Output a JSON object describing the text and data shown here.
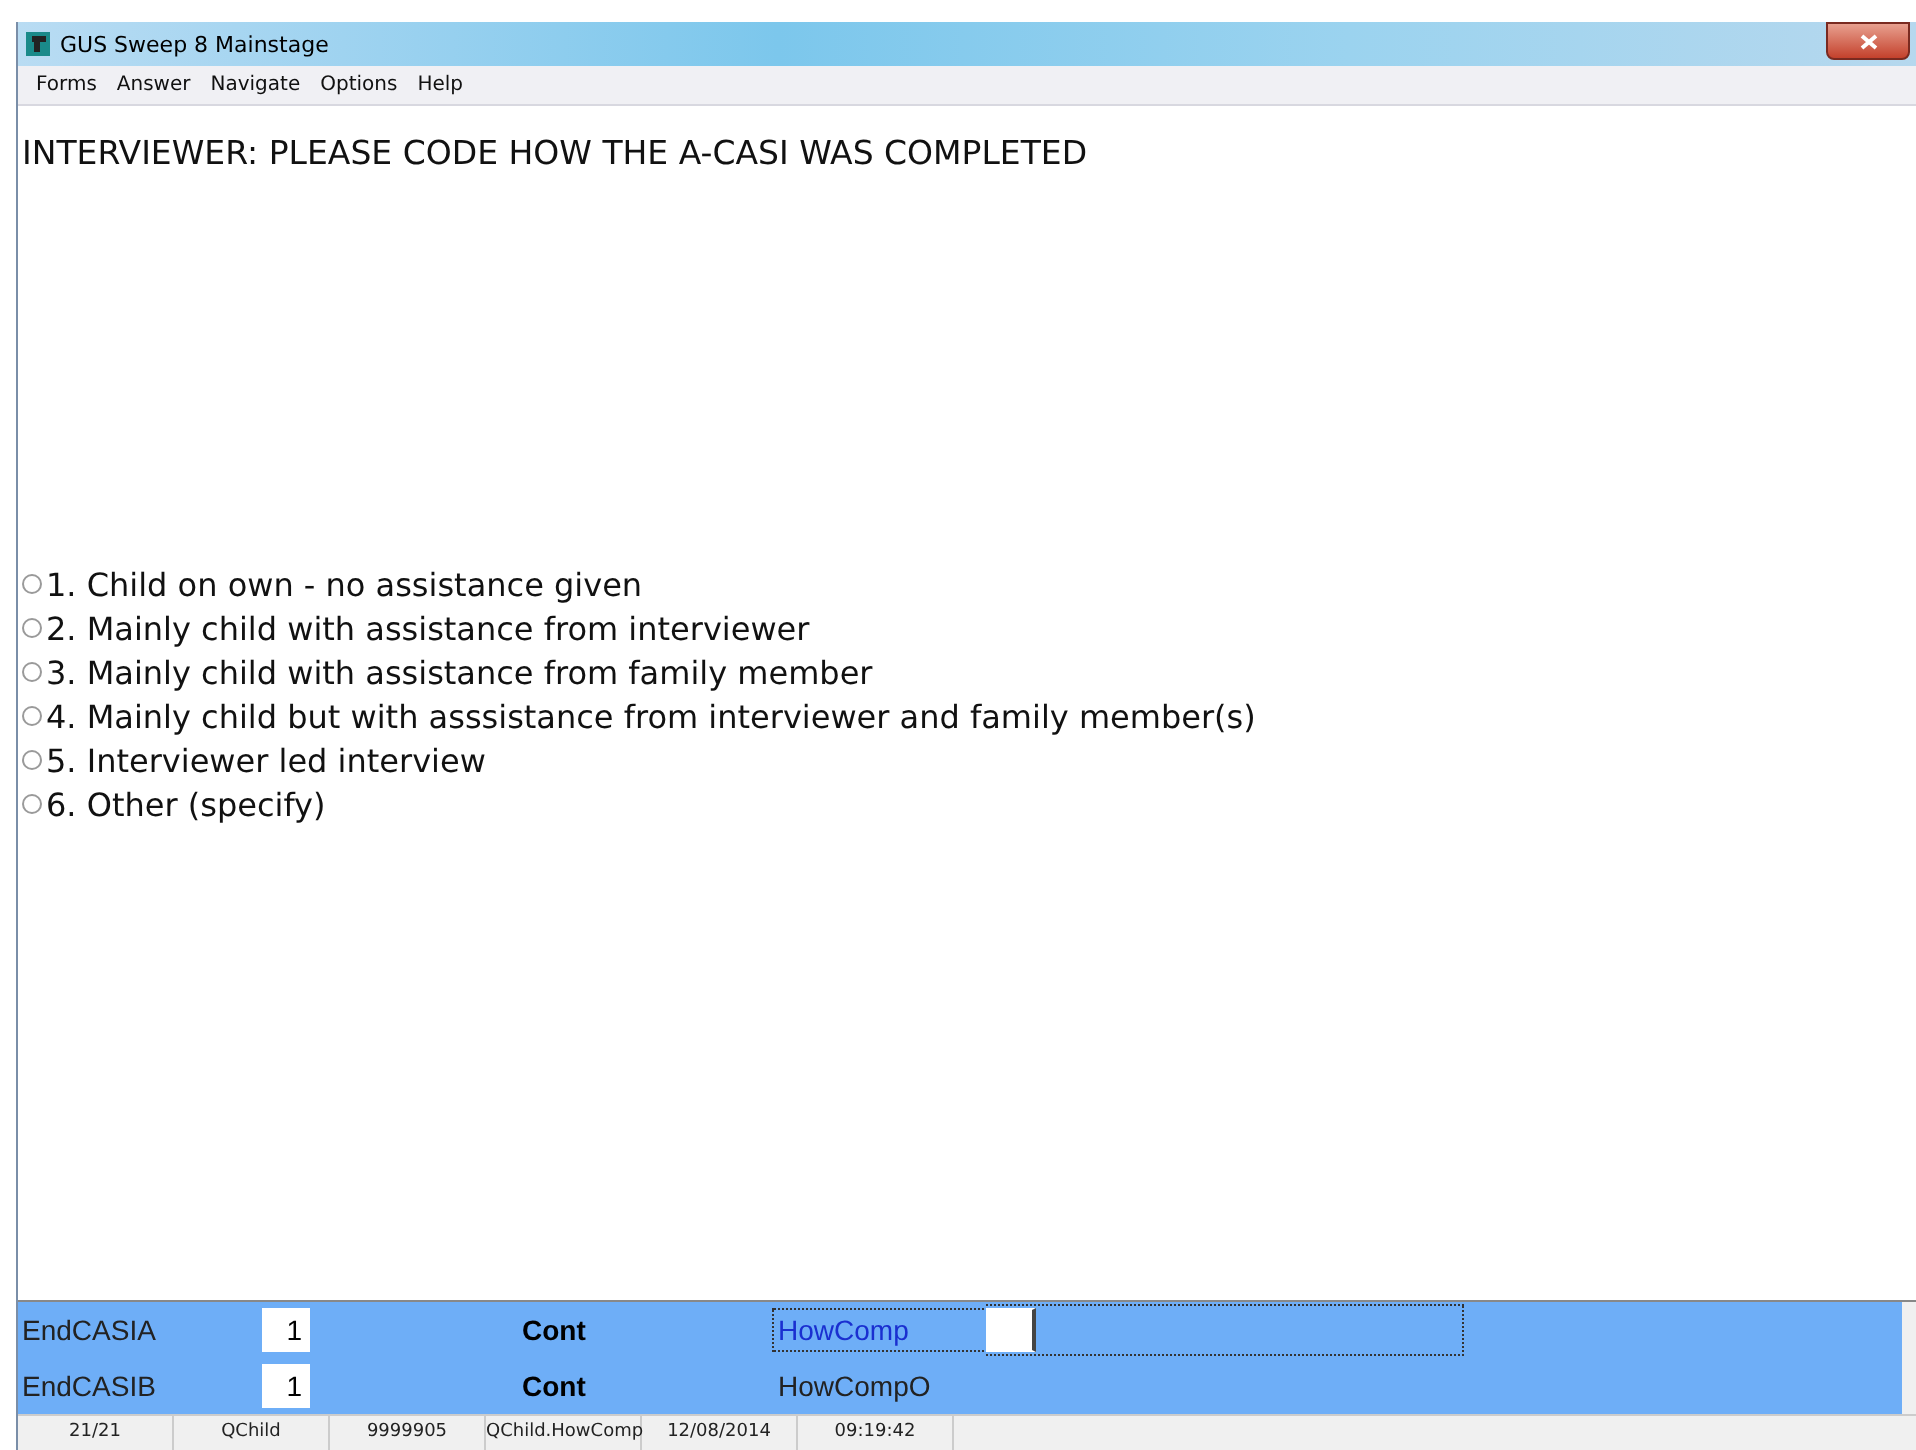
{
  "window": {
    "title": "GUS Sweep 8 Mainstage"
  },
  "menu": [
    "Forms",
    "Answer",
    "Navigate",
    "Options",
    "Help"
  ],
  "question": "INTERVIEWER: PLEASE CODE HOW THE A-CASI WAS COMPLETED",
  "options": [
    {
      "label": "1. Child on own - no assistance given",
      "selected": false
    },
    {
      "label": "2. Mainly child with assistance from interviewer",
      "selected": false
    },
    {
      "label": "3. Mainly child with assistance from family member",
      "selected": false
    },
    {
      "label": "4. Mainly child but with asssistance from interviewer and family member(s)",
      "selected": false
    },
    {
      "label": "5. Interviewer led interview",
      "selected": false
    },
    {
      "label": "6. Other (specify)",
      "selected": false
    }
  ],
  "fields": [
    {
      "name": "EndCASIA",
      "value": "1",
      "status": "Cont",
      "next": "HowComp",
      "focused": true
    },
    {
      "name": "EndCASIB",
      "value": "1",
      "status": "Cont",
      "next": "HowCompO",
      "focused": false
    }
  ],
  "status_bar": [
    "21/21",
    "QChild",
    "9999905",
    "QChild.HowComp",
    "12/08/2014",
    "09:19:42"
  ]
}
